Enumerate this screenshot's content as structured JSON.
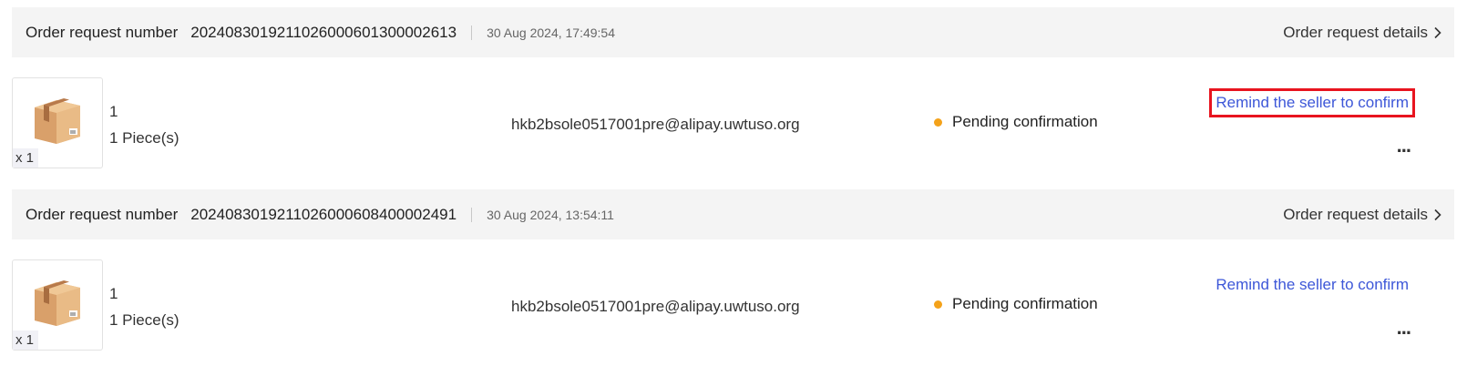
{
  "orders": [
    {
      "header": {
        "label": "Order request number",
        "number": "2024083019211026000601300002613",
        "time": "30 Aug 2024, 17:49:54",
        "details": "Order request details"
      },
      "product": {
        "qty_badge": "x 1",
        "line1": "1",
        "line2": "1 Piece(s)"
      },
      "seller_email": "hkb2bsole0517001pre@alipay.uwtuso.org",
      "status": "Pending confirmation",
      "action": "Remind the seller to confirm",
      "more": "..."
    },
    {
      "header": {
        "label": "Order request number",
        "number": "2024083019211026000608400002491",
        "time": "30 Aug 2024, 13:54:11",
        "details": "Order request details"
      },
      "product": {
        "qty_badge": "x 1",
        "line1": "1",
        "line2": "1 Piece(s)"
      },
      "seller_email": "hkb2bsole0517001pre@alipay.uwtuso.org",
      "status": "Pending confirmation",
      "action": "Remind the seller to confirm",
      "more": "..."
    }
  ],
  "colors": {
    "header_bg": "#f4f4f4",
    "link_blue": "#3d57d8",
    "status_dot": "#f4a21a",
    "highlight_red": "#e8141f"
  }
}
